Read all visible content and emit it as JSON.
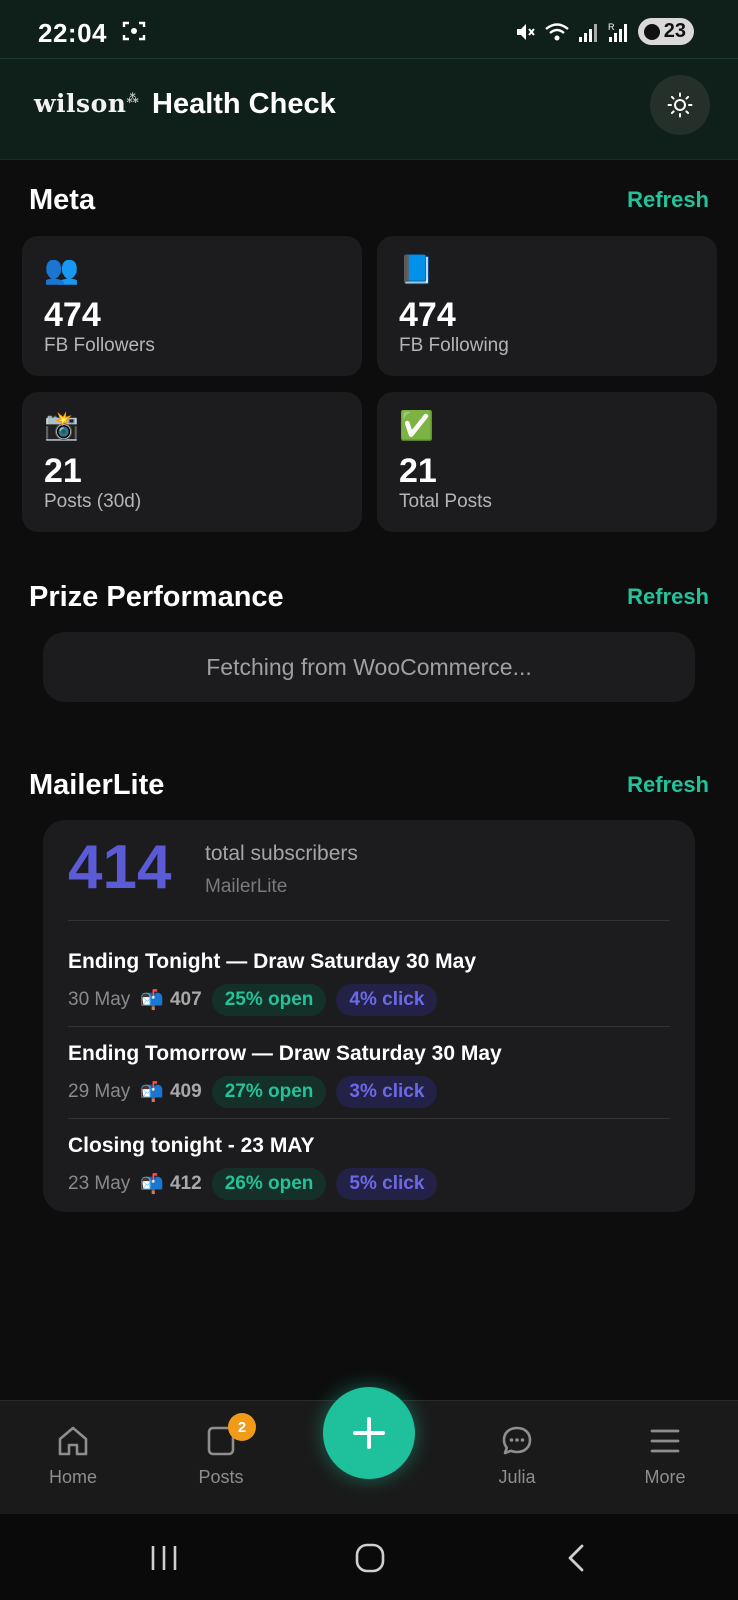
{
  "status_bar": {
    "time": "22:04",
    "battery": "23"
  },
  "header": {
    "logo": "wilson",
    "title": "Health Check",
    "theme_icon": "sun-icon"
  },
  "meta": {
    "title": "Meta",
    "refresh_label": "Refresh",
    "stats": [
      {
        "emoji": "👥",
        "value": "474",
        "label": "FB Followers"
      },
      {
        "emoji": "📘",
        "value": "474",
        "label": "FB Following"
      },
      {
        "emoji": "📸",
        "value": "21",
        "label": "Posts (30d)"
      },
      {
        "emoji": "✅",
        "value": "21",
        "label": "Total Posts"
      }
    ]
  },
  "prize": {
    "title": "Prize Performance",
    "refresh_label": "Refresh",
    "status": "Fetching from WooCommerce..."
  },
  "mailerlite": {
    "title": "MailerLite",
    "refresh_label": "Refresh",
    "total": "414",
    "total_label": "total subscribers",
    "provider": "MailerLite",
    "campaigns": [
      {
        "name": "Ending Tonight — Draw Saturday 30 May",
        "date": "30 May",
        "mailbox": "📬",
        "sent": "407",
        "open": "25% open",
        "click": "4% click"
      },
      {
        "name": "Ending Tomorrow — Draw Saturday 30 May",
        "date": "29 May",
        "mailbox": "📬",
        "sent": "409",
        "open": "27% open",
        "click": "3% click"
      },
      {
        "name": "Closing tonight - 23 MAY",
        "date": "23 May",
        "mailbox": "📬",
        "sent": "412",
        "open": "26% open",
        "click": "5% click"
      }
    ]
  },
  "bottom_nav": {
    "items": [
      {
        "label": "Home",
        "icon": "home-icon"
      },
      {
        "label": "Posts",
        "icon": "posts-icon",
        "badge": "2"
      },
      {
        "label": "Julia",
        "icon": "chat-icon"
      },
      {
        "label": "More",
        "icon": "menu-icon"
      }
    ],
    "fab_icon": "plus-icon"
  },
  "colors": {
    "accent": "#22c39a",
    "indigo": "#5b5bd6",
    "badge": "#f29b18"
  }
}
